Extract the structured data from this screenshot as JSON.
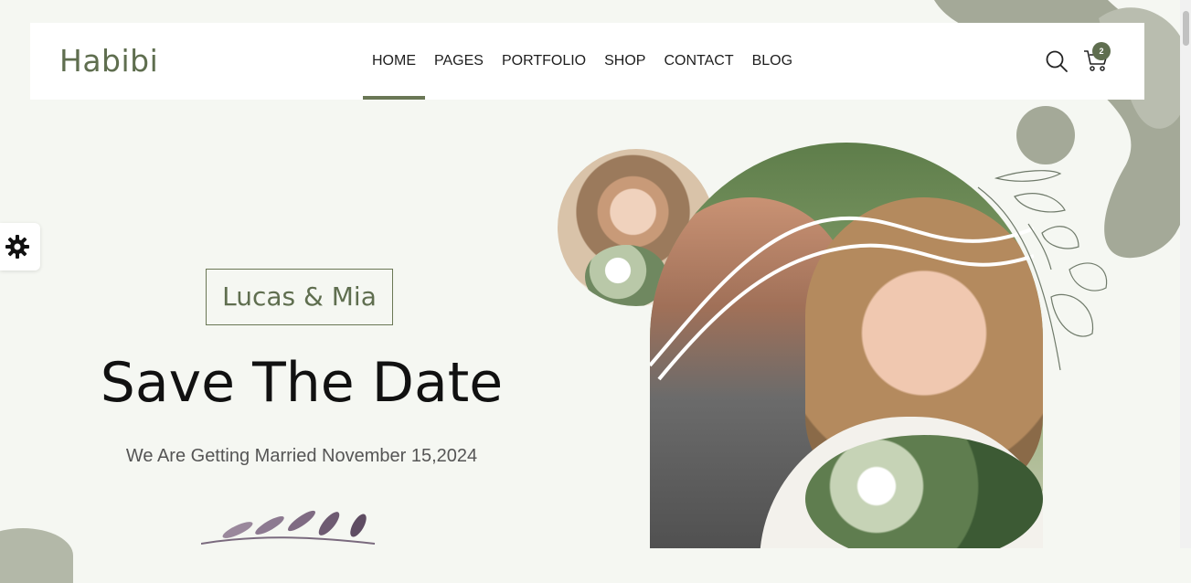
{
  "brand": {
    "logo": "Habibi",
    "accent_color": "#5f6e4f"
  },
  "nav": {
    "items": [
      {
        "label": "HOME",
        "active": true
      },
      {
        "label": "PAGES",
        "active": false
      },
      {
        "label": "PORTFOLIO",
        "active": false
      },
      {
        "label": "SHOP",
        "active": false
      },
      {
        "label": "CONTACT",
        "active": false
      },
      {
        "label": "BLOG",
        "active": false
      }
    ]
  },
  "header_actions": {
    "search_icon": "search-icon",
    "cart_icon": "cart-icon",
    "cart_count": "2"
  },
  "settings": {
    "icon": "gear-icon"
  },
  "hero": {
    "names": "Lucas & Mia",
    "headline": "Save The Date",
    "subtitle": "We Are Getting Married November 15,2024"
  },
  "colors": {
    "background": "#f5f7f2",
    "blob": "#a4a998",
    "text_dark": "#111111"
  }
}
